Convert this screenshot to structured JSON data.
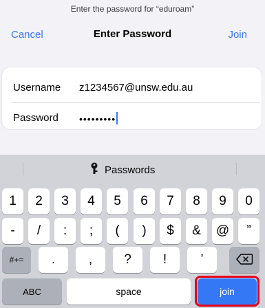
{
  "header": {
    "prompt": "Enter the password for “eduroam”",
    "cancel": "Cancel",
    "title": "Enter Password",
    "join": "Join"
  },
  "form": {
    "username_label": "Username",
    "username_value": "z1234567@unsw.edu.au",
    "password_label": "Password",
    "password_masked": "•••••••••"
  },
  "keyboard": {
    "passwords_suggestion": "Passwords",
    "row1": [
      "1",
      "2",
      "3",
      "4",
      "5",
      "6",
      "7",
      "8",
      "9",
      "0"
    ],
    "row2": [
      "-",
      "/",
      ":",
      ";",
      "(",
      ")",
      "$",
      "&",
      "@",
      "”"
    ],
    "row3_mode": "#+=",
    "row3": [
      ".",
      ",",
      "?",
      "!",
      "’"
    ],
    "abc": "ABC",
    "space": "space",
    "join": "join"
  },
  "colors": {
    "accent": "#3478f6",
    "highlight": "#e4001b"
  },
  "icons": {
    "key": "key-icon",
    "delete": "backspace-icon"
  }
}
